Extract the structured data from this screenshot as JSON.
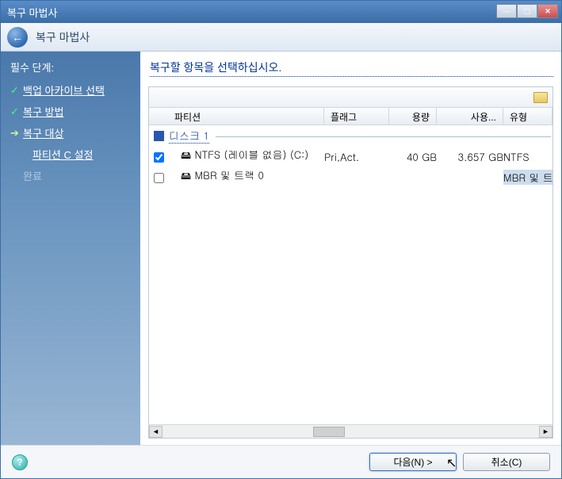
{
  "window": {
    "title": "복구 마법사"
  },
  "header": {
    "title": "복구 마법사"
  },
  "sidebar": {
    "heading": "필수 단계:",
    "steps": [
      {
        "mark": "✓",
        "label": "백업 아카이브 선택"
      },
      {
        "mark": "✓",
        "label": "복구 방법"
      },
      {
        "mark": "➔",
        "label": "복구 대상"
      }
    ],
    "substep": "파티션 C 설정",
    "disabled": "완료"
  },
  "main": {
    "instruction": "복구할 항목을 선택하십시오.",
    "columns": {
      "partition": "파티션",
      "flags": "플래그",
      "capacity": "용량",
      "used": "사용...",
      "type": "유형"
    },
    "group": "디스크 1",
    "rows": [
      {
        "checked": true,
        "label": "NTFS (레이블 없음) (C:)",
        "flags": "Pri,Act.",
        "capacity": "40 GB",
        "used": "3.657 GB",
        "type": "NTFS"
      },
      {
        "checked": false,
        "label": "MBR 및 트랙 0",
        "flags": "",
        "capacity": "",
        "used": "",
        "type": "MBR 및 트"
      }
    ]
  },
  "footer": {
    "next": "다음(N) >",
    "cancel": "취소(C)"
  }
}
